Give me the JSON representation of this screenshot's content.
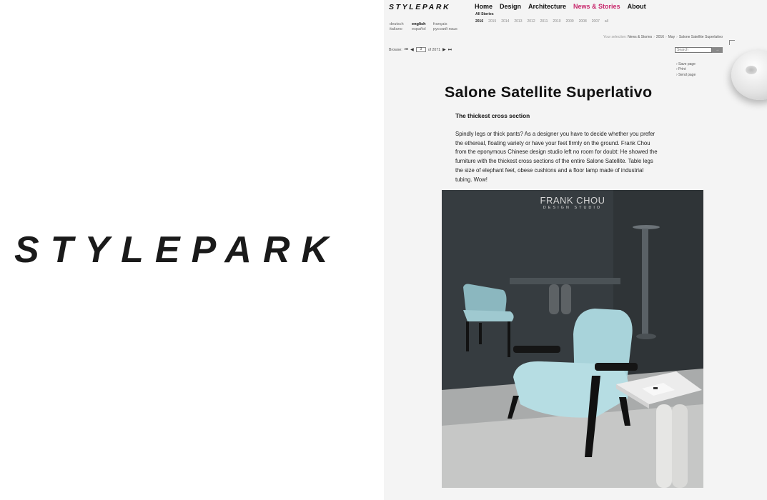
{
  "brand": {
    "big_logo": "STYLEPARK",
    "site_logo": "STYLEPARK"
  },
  "nav": {
    "items": [
      {
        "label": "Home",
        "active": false
      },
      {
        "label": "Design",
        "active": false
      },
      {
        "label": "Architecture",
        "active": false
      },
      {
        "label": "News & Stories",
        "active": true
      },
      {
        "label": "About",
        "active": false
      }
    ],
    "subnav_label": "All Stories",
    "years": [
      "2016",
      "2015",
      "2014",
      "2013",
      "2012",
      "2011",
      "2010",
      "2009",
      "2008",
      "2007",
      "all"
    ],
    "active_year": "2016",
    "active_color": "#c8266b"
  },
  "languages": [
    "deutsch",
    "english",
    "français",
    "italiano",
    "español",
    "русский язык"
  ],
  "active_language": "english",
  "breadcrumb": {
    "prefix": "Your selection:",
    "items": [
      "News & Stories",
      "2016",
      "May",
      "Salone Satellite Superlativo"
    ]
  },
  "browse": {
    "label": "Browse:",
    "current_page": "3",
    "of_label": "of 2071"
  },
  "search": {
    "placeholder": "Search"
  },
  "actions": [
    "› Save page",
    "› Print",
    "› Send page"
  ],
  "article": {
    "title": "Salone Satellite Superlativo",
    "subtitle": "The thickest cross section",
    "body": "Spindly legs or thick pants? As a designer you have to decide whether you prefer the ethereal, floating variety or have your feet firmly on the ground. Frank Chou from the eponymous Chinese design studio left no room for doubt: He showed the furniture with the thickest cross sections of the entire Salone Satellite. Table legs the size of elephant feet, obese cushions and a floor lamp made of industrial tubing. Wow!"
  },
  "photo": {
    "wordmark_line1": "FRANK CHOU",
    "wordmark_line2": "DESIGN STUDIO"
  },
  "icons": [
    "first-page-icon",
    "prev-page-icon",
    "next-page-icon",
    "last-page-icon",
    "search-go-icon"
  ]
}
